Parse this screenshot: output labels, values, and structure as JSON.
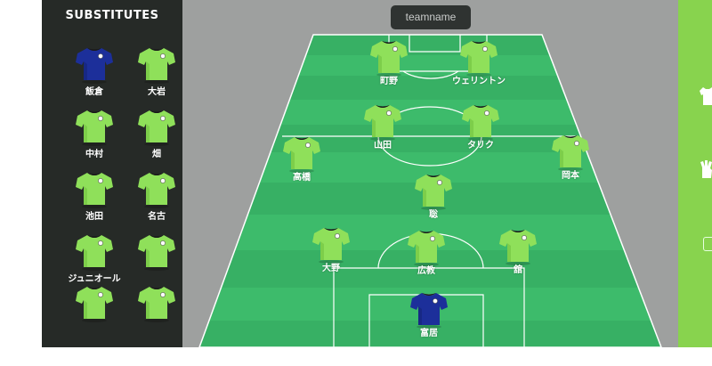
{
  "substitutes": {
    "title": "SUBSTITUTES",
    "players": [
      {
        "name": "飯倉",
        "kit": "keeper"
      },
      {
        "name": "大岩",
        "kit": "field"
      },
      {
        "name": "中村",
        "kit": "field"
      },
      {
        "name": "畑",
        "kit": "field"
      },
      {
        "name": "池田",
        "kit": "field"
      },
      {
        "name": "名古",
        "kit": "field"
      },
      {
        "name": "ジュニオール",
        "kit": "field"
      },
      {
        "name": "",
        "kit": "field"
      },
      {
        "name": "",
        "kit": "field"
      },
      {
        "name": "",
        "kit": "field"
      }
    ]
  },
  "team": {
    "name_button": "teamname"
  },
  "lineup": [
    {
      "id": "machino",
      "name": "町野",
      "kit": "field"
    },
    {
      "id": "wellington",
      "name": "ウェリントン",
      "kit": "field"
    },
    {
      "id": "yamada",
      "name": "山田",
      "kit": "field"
    },
    {
      "id": "tariku",
      "name": "タリク",
      "kit": "field"
    },
    {
      "id": "takahashi",
      "name": "高橋",
      "kit": "field"
    },
    {
      "id": "okamoto",
      "name": "岡本",
      "kit": "field"
    },
    {
      "id": "satoshi",
      "name": "聡",
      "kit": "field"
    },
    {
      "id": "ono",
      "name": "大野",
      "kit": "field"
    },
    {
      "id": "hironori",
      "name": "広教",
      "kit": "field"
    },
    {
      "id": "tate",
      "name": "舘",
      "kit": "field"
    },
    {
      "id": "tomii",
      "name": "富居",
      "kit": "keeper"
    }
  ],
  "colors": {
    "field_kit": "#8fe05a",
    "field_kit_shade": "#6fbf3e",
    "keeper_kit": "#1c2f9a",
    "keeper_kit_shade": "#142374",
    "pitch_light": "#3dbb6b",
    "pitch_dark": "#35ad61",
    "panel_dark": "#262a27",
    "side_panel": "#88d34e"
  },
  "tools": [
    {
      "icon": "shirt-icon"
    },
    {
      "icon": "glove-icon"
    }
  ]
}
